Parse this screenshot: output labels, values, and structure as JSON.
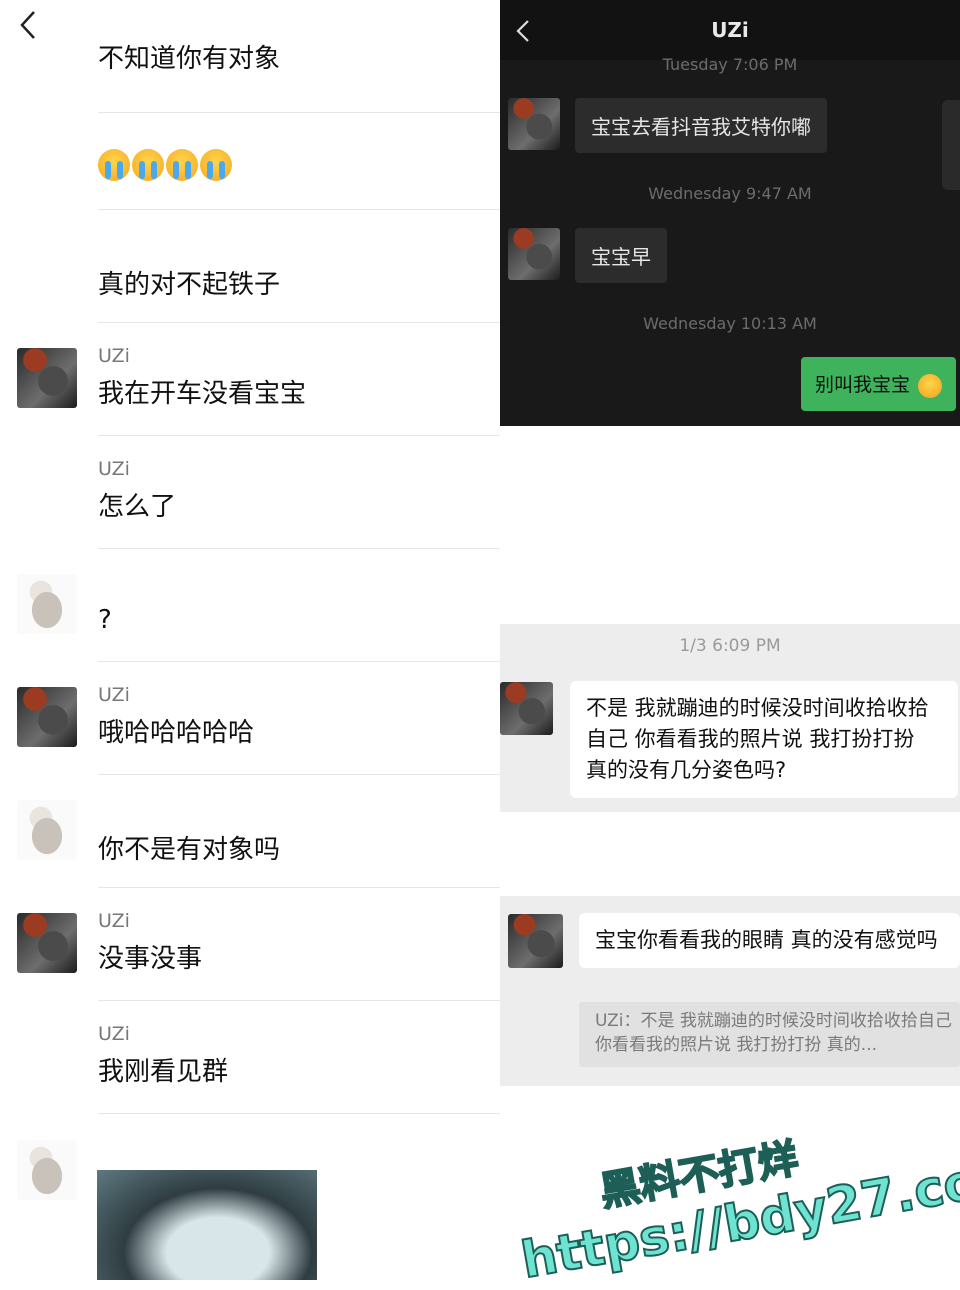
{
  "left_chat": {
    "messages": [
      {
        "sender": "",
        "text": "不知道你有对象"
      },
      {
        "sender": "",
        "text": ""
      },
      {
        "sender": "",
        "text": "真的对不起铁子"
      },
      {
        "sender": "UZi",
        "text": "我在开车没看宝宝"
      },
      {
        "sender": "UZi",
        "text": "怎么了"
      },
      {
        "sender": "",
        "text": "?"
      },
      {
        "sender": "UZi",
        "text": "哦哈哈哈哈哈"
      },
      {
        "sender": "",
        "text": "你不是有对象吗"
      },
      {
        "sender": "UZi",
        "text": "没事没事"
      },
      {
        "sender": "UZi",
        "text": "我刚看见群"
      }
    ]
  },
  "dark_chat": {
    "title": "UZi",
    "timestamps": [
      "Tuesday 7:06 PM",
      "Wednesday 9:47 AM",
      "Wednesday 10:13 AM"
    ],
    "incoming": [
      "宝宝去看抖音我艾特你嘟",
      "宝宝早"
    ],
    "outgoing": "别叫我宝宝"
  },
  "light_chat": {
    "timestamp": "1/3 6:09 PM",
    "message": "不是 我就蹦迪的时候没时间收拾收拾自己 你看看我的照片说 我打扮打扮 真的没有几分姿色吗?"
  },
  "reply_chat": {
    "message": "宝宝你看看我的眼睛 真的没有感觉吗",
    "quote": "UZi：不是 我就蹦迪的时候没时间收拾收拾自己 你看看我的照片说 我打扮打扮 真的..."
  },
  "watermark": {
    "line1": "黑料不打烊",
    "line2": "https://bdy27.co"
  }
}
